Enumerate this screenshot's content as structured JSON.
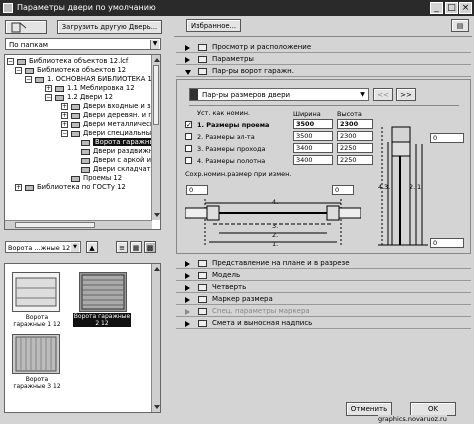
{
  "window": {
    "title": "Параметры двери по умолчанию",
    "minimize": "_",
    "maximize": "□",
    "close": "×"
  },
  "header": {
    "load_other": "Загрузить другую Дверь...",
    "favorites": "Избранное...",
    "folder_select": "По папкам"
  },
  "tree": {
    "items": [
      {
        "label": "Библиотека объектов 12.lcf",
        "expander": "−"
      },
      {
        "label": "Библиотека объектов 12",
        "expander": "−"
      },
      {
        "label": "1. ОСНОВНАЯ БИБЛИОТЕКА 12",
        "expander": "−"
      },
      {
        "label": "1.1 Меблировка 12",
        "expander": "+"
      },
      {
        "label": "1.2 Двери 12",
        "expander": "−"
      },
      {
        "label": "Двери входные и запасные",
        "expander": "+"
      },
      {
        "label": "Двери деревян. и пластик.",
        "expander": "+"
      },
      {
        "label": "Двери металлические",
        "expander": "+"
      },
      {
        "label": "Двери специальные 12",
        "expander": "−"
      },
      {
        "label": "Ворота гаражные 12"
      },
      {
        "label": "Двери раздвижные"
      },
      {
        "label": "Двери с аркой и вент."
      },
      {
        "label": "Двери складчатые"
      },
      {
        "label": "Проемы 12"
      },
      {
        "label": "Библиотека по ГОСТу 12",
        "expander": "+"
      }
    ]
  },
  "browser": {
    "folder_dropdown": "Ворота ...жные 12",
    "thumbs": [
      {
        "label": "Ворота гаражные 1 12"
      },
      {
        "label": "Ворота гаражные 2 12"
      },
      {
        "label": "Ворота гаражные 3 12"
      }
    ]
  },
  "sections": {
    "s1": "Просмотр и расположение",
    "s2": "Параметры",
    "s3": "Пар-ры ворот гаражн.",
    "s4": "Представление на плане и в разрезе",
    "s5": "Модель",
    "s6": "Четверть",
    "s7": "Маркер размера",
    "s8": "Спец. параметры маркера",
    "s9": "Смета и выносная надпись"
  },
  "params": {
    "sizes_dropdown": "Пар-ры размеров двери",
    "prev": "<<",
    "next": ">>",
    "col_set": "Уст. как номин.",
    "col_width": "Ширина",
    "col_height": "Высота",
    "rows": [
      {
        "label": "1. Размеры проема",
        "checked": "✓",
        "width": "3500",
        "height": "2300"
      },
      {
        "label": "2. Размеры эл-та",
        "checked": "",
        "width": "3500",
        "height": "2300"
      },
      {
        "label": "3. Размеры прохода",
        "checked": "",
        "width": "3400",
        "height": "2250"
      },
      {
        "label": "4. Размеры полотна",
        "checked": "",
        "width": "3400",
        "height": "2250"
      }
    ],
    "save_nominal": "Сохр.номин.размер при измен.",
    "offset_left": "0",
    "offset_right": "0",
    "offset_side": "0",
    "offset_bottom": "0",
    "dim_labels": [
      "1.",
      "2.",
      "3.",
      "4."
    ]
  },
  "footer": {
    "cancel": "Отменить",
    "ok": "OK",
    "watermark": "graphics.novaruoz.ru"
  },
  "colors": {
    "titlebar": "#2a2a2a",
    "selection": "#111111",
    "panel": "#d4d4d4"
  }
}
